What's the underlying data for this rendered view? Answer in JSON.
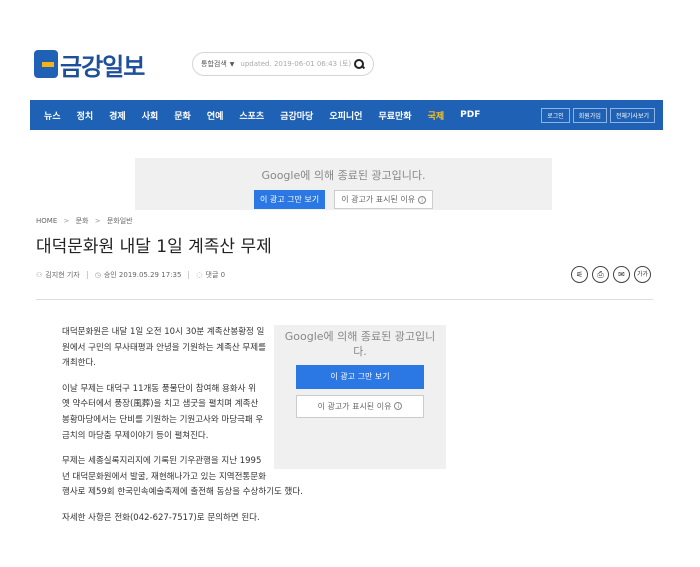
{
  "brand": {
    "name": "금강일보"
  },
  "search": {
    "select_label": "통합검색",
    "updated": "updated. 2019-06-01 06:43 (토)"
  },
  "nav": {
    "items": [
      "뉴스",
      "정치",
      "경제",
      "사회",
      "문화",
      "연예",
      "스포츠",
      "금강마당",
      "오피니언",
      "무료만화",
      "국제",
      "PDF"
    ],
    "active_index": 10,
    "right_buttons": [
      "로그인",
      "회원가입",
      "전체기사보기"
    ]
  },
  "ad": {
    "line1": "Google에 의해 종료된 광고입니다.",
    "stop_label": "이 광고 그만 보기",
    "why_label": "이 광고가 표시된 이유",
    "info_symbol": "i"
  },
  "breadcrumb": {
    "home": "HOME",
    "section": "문화",
    "subsection": "문화일반",
    "separator": ">"
  },
  "article": {
    "title": "대덕문화원 내달 1일 계족산 무제",
    "author": "김지현 기자",
    "approved": "승인 2019.05.29 17:35",
    "comments": "댓글 0",
    "paragraphs": [
      "대덕문화원은 내달 1일 오전 10시 30분 계족산봉황정 일원에서 구민의 무사태평과 안녕을 기원하는 계족산 무제를 개최한다.",
      "이날 무제는 대덕구 11개동 풍물단이 참여해 용화사 위 옛 약수터에서 풍장(風葬)을 치고 샘굿을 펼치며 계족산봉황마당에서는 단비를 기원하는 기원고사와 마당극패 우금치의 마당춤 무제이야기 등이 펼쳐진다.",
      "무제는 세종실록지리지에 기록된 기우관행을 지난 1995년 대덕문화원에서 발굴, 재현해나가고 있는 지역전통문화행사로 제59회 한국민속예술축제에 출전해 동상을 수상하기도 했다.",
      "자세한 사항은 전화(042-627-7517)로 문의하면 된다."
    ]
  },
  "tools": {
    "share": "⚟",
    "print": "⎙",
    "email": "✉",
    "font_size": "가가"
  },
  "colors": {
    "brand_blue": "#1f61b4",
    "nav_active": "#ffc21a",
    "ad_button": "#2b78e4"
  }
}
